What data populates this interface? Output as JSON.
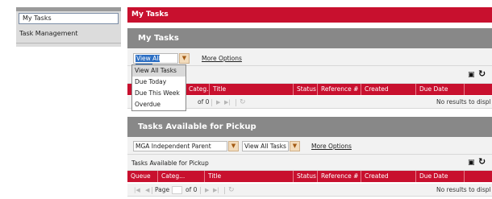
{
  "sidebar": {
    "items": [
      {
        "label": "My Tasks"
      },
      {
        "label": "Task Management"
      }
    ]
  },
  "header": {
    "title": "My Tasks"
  },
  "my_tasks": {
    "title": "My Tasks",
    "filter_value": "View All Tasks",
    "more_options": "More Options",
    "dropdown_options": [
      "View All Tasks",
      "Due Today",
      "Due This Week",
      "Overdue"
    ],
    "columns": [
      "Categ...",
      "Title",
      "Status",
      "Reference #",
      "Created",
      "Due Date"
    ],
    "pager": {
      "of": "of 0",
      "no_results": "No results to displ"
    }
  },
  "pickup": {
    "title": "Tasks Available for Pickup",
    "group_value": "MGA Independent Parent",
    "filter_value": "View All Tasks",
    "more_options": "More Options",
    "sub_label": "Tasks Available for Pickup",
    "columns": [
      "Queue",
      "Categ...",
      "Title",
      "Status",
      "Reference #",
      "Created",
      "Due Date"
    ],
    "pager": {
      "page_label": "Page",
      "of": "of 0",
      "no_results": "No results to displ"
    }
  },
  "icons": [
    "save-icon",
    "refresh-icon",
    "first-page-icon",
    "prev-page-icon",
    "next-page-icon",
    "last-page-icon",
    "reload-icon",
    "chevron-down-icon"
  ],
  "colors": {
    "header_red": "#c8102e",
    "section_gray": "#888888",
    "toolbar_bg": "#f2f2f2"
  }
}
